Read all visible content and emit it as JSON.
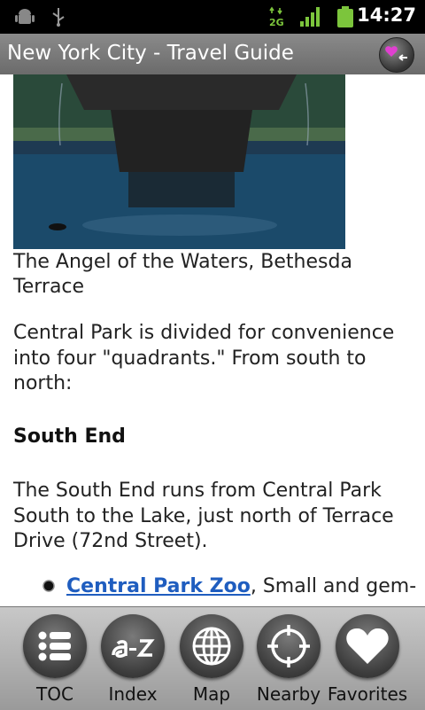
{
  "status_bar": {
    "time": "14:27",
    "network": "2G"
  },
  "title_bar": {
    "title": "New York City - Travel Guide"
  },
  "article": {
    "caption": "The Angel of the Waters, Bethesda Terrace",
    "intro": "Central Park is divided for convenience into four \"quadrants.\" From south to north:",
    "section_heading": "South End",
    "section_text": "The South End runs from Central Park South to the Lake, just north of Terrace Drive (72nd Street).",
    "bullet_link": "Central Park Zoo",
    "bullet_text": ", Small and gem-"
  },
  "toolbar": {
    "toc": "TOC",
    "index": "Index",
    "map": "Map",
    "nearby": "Nearby",
    "favorites": "Favorites"
  }
}
